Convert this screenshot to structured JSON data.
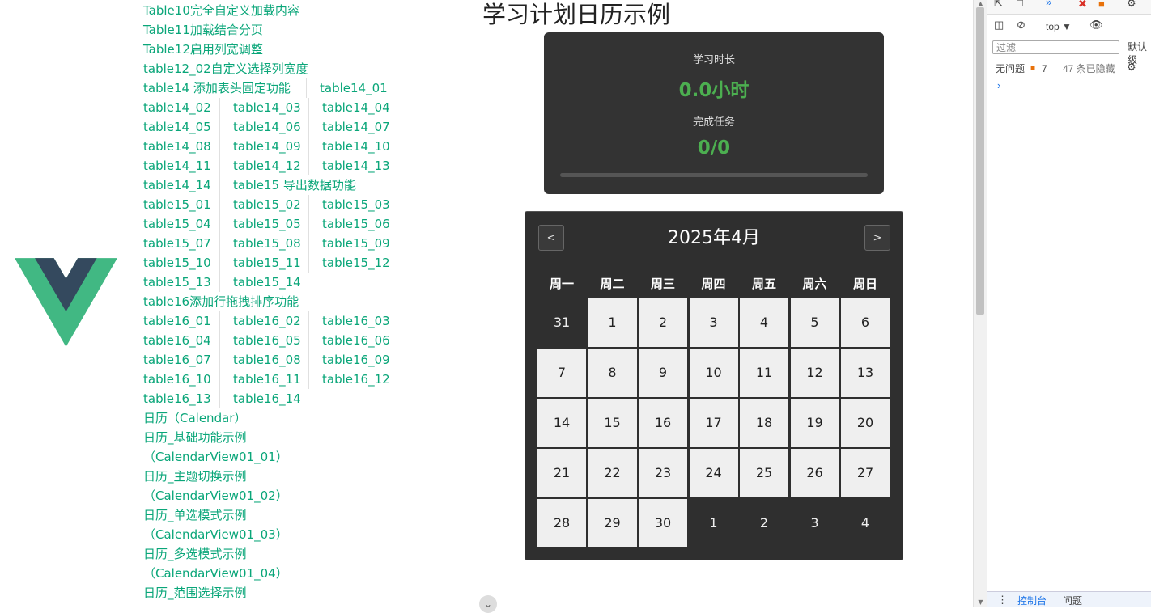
{
  "nav_lines": [
    {
      "items": [
        "Table10完全自定义加载内容"
      ]
    },
    {
      "items": [
        "Table11加载结合分页"
      ]
    },
    {
      "items": [
        "Table12启用列宽调整"
      ]
    },
    {
      "items": [
        "table12_02自定义选择列宽度"
      ]
    },
    {
      "items": [
        "table14 添加表头固定功能",
        "table14_01"
      ],
      "layout": "wide"
    },
    {
      "items": [
        "table14_02",
        "table14_03",
        "table14_04"
      ]
    },
    {
      "items": [
        "table14_05",
        "table14_06",
        "table14_07"
      ]
    },
    {
      "items": [
        "table14_08",
        "table14_09",
        "table14_10"
      ]
    },
    {
      "items": [
        "table14_11",
        "table14_12",
        "table14_13"
      ]
    },
    {
      "items": [
        "table14_14",
        "table15 导出数据功能"
      ]
    },
    {
      "items": [
        "table15_01",
        "table15_02",
        "table15_03"
      ]
    },
    {
      "items": [
        "table15_04",
        "table15_05",
        "table15_06"
      ]
    },
    {
      "items": [
        "table15_07",
        "table15_08",
        "table15_09"
      ]
    },
    {
      "items": [
        "table15_10",
        "table15_11",
        "table15_12"
      ]
    },
    {
      "items": [
        "table15_13",
        "table15_14"
      ]
    },
    {
      "items": [
        "table16添加行拖拽排序功能"
      ]
    },
    {
      "items": [
        "table16_01",
        "table16_02",
        "table16_03"
      ]
    },
    {
      "items": [
        "table16_04",
        "table16_05",
        "table16_06"
      ]
    },
    {
      "items": [
        "table16_07",
        "table16_08",
        "table16_09"
      ]
    },
    {
      "items": [
        "table16_10",
        "table16_11",
        "table16_12"
      ]
    },
    {
      "items": [
        "table16_13",
        "table16_14"
      ]
    },
    {
      "items": [
        "日历（Calendar）"
      ]
    },
    {
      "items": [
        "日历_基础功能示例"
      ]
    },
    {
      "items": [
        "（CalendarView01_01）"
      ]
    },
    {
      "items": [
        "日历_主题切换示例"
      ]
    },
    {
      "items": [
        "（CalendarView01_02）"
      ]
    },
    {
      "items": [
        "日历_单选模式示例"
      ]
    },
    {
      "items": [
        "（CalendarView01_03）"
      ]
    },
    {
      "items": [
        "日历_多选模式示例"
      ]
    },
    {
      "items": [
        "（CalendarView01_04）"
      ]
    },
    {
      "items": [
        "日历_范围选择示例"
      ]
    }
  ],
  "page_title": "学习计划日历示例",
  "stats": {
    "study_label": "学习时长",
    "study_value": "0.0小时",
    "tasks_label": "完成任务",
    "tasks_value": "0/0",
    "progress": 0
  },
  "calendar": {
    "prev_label": "<",
    "next_label": ">",
    "month_title": "2025年4月",
    "weekdays": [
      "周一",
      "周二",
      "周三",
      "周四",
      "周五",
      "周六",
      "周日"
    ],
    "weeks": [
      [
        {
          "d": "31",
          "cur": false
        },
        {
          "d": "1",
          "cur": true
        },
        {
          "d": "2",
          "cur": true
        },
        {
          "d": "3",
          "cur": true
        },
        {
          "d": "4",
          "cur": true
        },
        {
          "d": "5",
          "cur": true
        },
        {
          "d": "6",
          "cur": true
        }
      ],
      [
        {
          "d": "7",
          "cur": true
        },
        {
          "d": "8",
          "cur": true
        },
        {
          "d": "9",
          "cur": true
        },
        {
          "d": "10",
          "cur": true
        },
        {
          "d": "11",
          "cur": true
        },
        {
          "d": "12",
          "cur": true
        },
        {
          "d": "13",
          "cur": true
        }
      ],
      [
        {
          "d": "14",
          "cur": true
        },
        {
          "d": "15",
          "cur": true
        },
        {
          "d": "16",
          "cur": true
        },
        {
          "d": "17",
          "cur": true
        },
        {
          "d": "18",
          "cur": true
        },
        {
          "d": "19",
          "cur": true
        },
        {
          "d": "20",
          "cur": true
        }
      ],
      [
        {
          "d": "21",
          "cur": true
        },
        {
          "d": "22",
          "cur": true
        },
        {
          "d": "23",
          "cur": true
        },
        {
          "d": "24",
          "cur": true
        },
        {
          "d": "25",
          "cur": true
        },
        {
          "d": "26",
          "cur": true
        },
        {
          "d": "27",
          "cur": true
        }
      ],
      [
        {
          "d": "28",
          "cur": true
        },
        {
          "d": "29",
          "cur": true
        },
        {
          "d": "30",
          "cur": true
        },
        {
          "d": "1",
          "cur": false
        },
        {
          "d": "2",
          "cur": false
        },
        {
          "d": "3",
          "cur": false
        },
        {
          "d": "4",
          "cur": false
        }
      ]
    ]
  },
  "devtools": {
    "context": "top",
    "filter_placeholder": "过滤",
    "default_levels": "默认级",
    "no_issues": "无问题",
    "issue_count": "7",
    "hidden_count": "47 条已隐藏",
    "console_tab": "控制台",
    "issues_tab": "问题",
    "prompt": "›"
  },
  "colors": {
    "link": "#0aa679",
    "accent": "#4caf50",
    "panel": "#333333",
    "day_bg": "#efefef"
  }
}
